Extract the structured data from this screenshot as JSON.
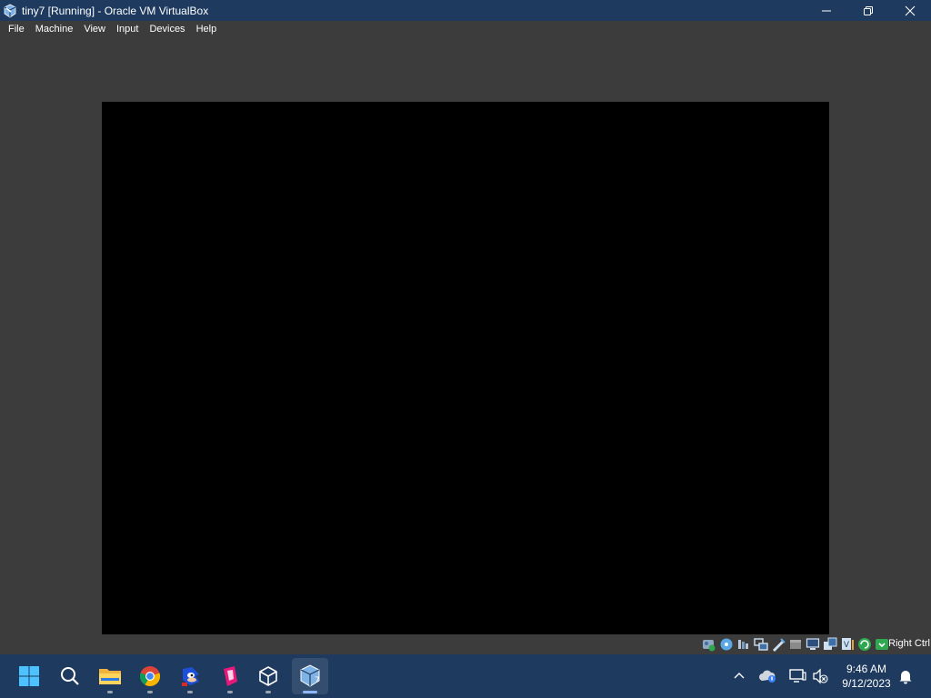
{
  "window": {
    "title": "tiny7 [Running] - Oracle VM VirtualBox",
    "app_icon": "virtualbox-icon",
    "controls": [
      "minimize-icon",
      "restore-icon",
      "close-icon"
    ]
  },
  "menubar": {
    "items": [
      {
        "label": "File"
      },
      {
        "label": "Machine"
      },
      {
        "label": "View"
      },
      {
        "label": "Input"
      },
      {
        "label": "Devices"
      },
      {
        "label": "Help"
      }
    ]
  },
  "vm": {
    "screen_color": "#000000"
  },
  "statusbar": {
    "icons": [
      "hard-disk-icon",
      "optical-drive-icon",
      "audio-icon",
      "network-icon",
      "usb-icon",
      "shared-folders-icon",
      "display-icon",
      "video-capture-icon",
      "virtualization-icon",
      "mouse-integration-icon",
      "keyboard-icon"
    ],
    "host_key": "Right Ctrl"
  },
  "taskbar": {
    "apps": [
      {
        "name": "start-button",
        "icon": "windows-start-icon"
      },
      {
        "name": "search-button",
        "icon": "search-icon"
      },
      {
        "name": "file-explorer",
        "icon": "folder-icon",
        "running": true
      },
      {
        "name": "chrome",
        "icon": "chrome-icon",
        "running": true
      },
      {
        "name": "sonic",
        "icon": "sonic-icon",
        "running": true
      },
      {
        "name": "pink-app",
        "icon": "pink-app-icon",
        "running": true
      },
      {
        "name": "virtualbox-manager",
        "icon": "cube-icon",
        "running": true
      },
      {
        "name": "tiny7-vm",
        "icon": "virtualbox-vm-icon",
        "running": true,
        "active": true
      }
    ],
    "tray": {
      "icons": [
        "chevron-up-icon",
        "onedrive-icon",
        "network-icon",
        "volume-muted-icon",
        "notification-bell-icon"
      ],
      "time": "9:46 AM",
      "date": "9/12/2023"
    }
  },
  "colors": {
    "titlebar": "#1e3a5f",
    "background": "#3c3c3c",
    "taskbar": "#1e3a5f",
    "accent": "#8fb7ff"
  }
}
